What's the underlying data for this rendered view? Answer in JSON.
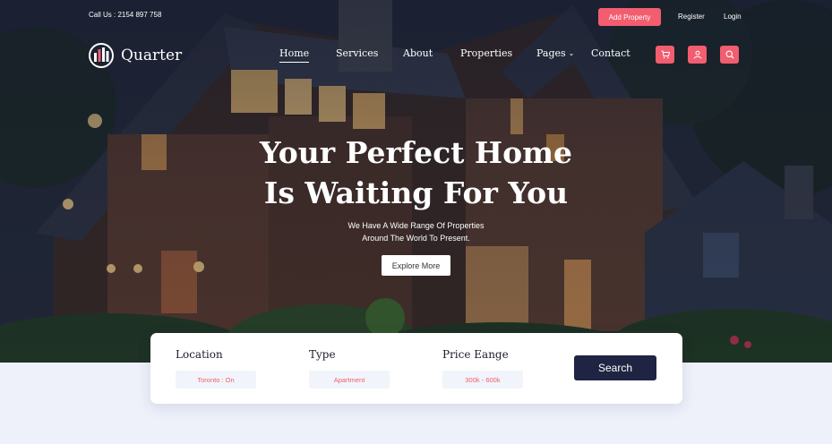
{
  "topbar": {
    "phone": "Call Us :  2154 897 758",
    "add_property": "Add Property",
    "register": "Register",
    "login": "Login"
  },
  "brand": {
    "name": "Quarter"
  },
  "nav": {
    "items": [
      {
        "label": "Home",
        "active": true
      },
      {
        "label": "Services"
      },
      {
        "label": "About"
      },
      {
        "label": "Properties"
      },
      {
        "label": "Pages",
        "dropdown": true
      },
      {
        "label": "Contact"
      }
    ],
    "icons": [
      "cart-icon",
      "user-icon",
      "search-icon"
    ]
  },
  "hero": {
    "title_line1": "Your Perfect Home",
    "title_line2": "Is Waiting For You",
    "subtitle_line1": "We Have A Wide Range Of Properties",
    "subtitle_line2": "Around The World To Present.",
    "cta": "Explore More"
  },
  "search": {
    "location_label": "Location",
    "location_value": "Toronto : On",
    "type_label": "Type",
    "type_value": "Apartment",
    "price_label": "Price Eange",
    "price_value": "300k - 600k",
    "button": "Search"
  },
  "colors": {
    "accent": "#f25d6f",
    "dark": "#1f2442",
    "page_bg": "#eef1fa"
  }
}
